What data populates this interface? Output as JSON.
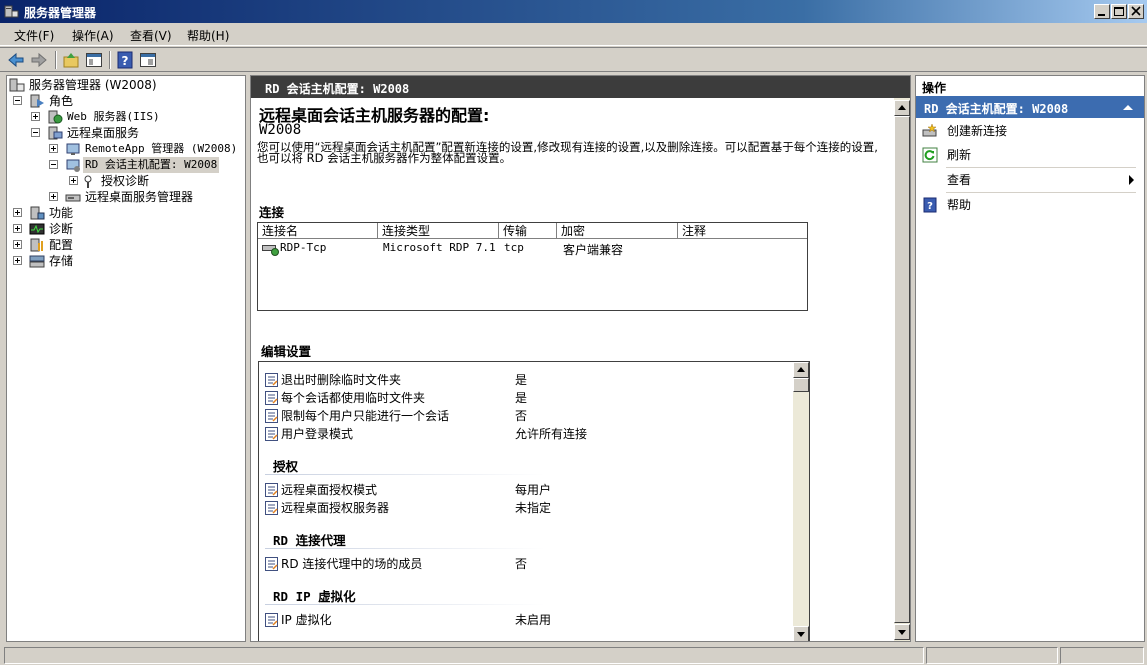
{
  "window": {
    "title": "服务器管理器",
    "controls": [
      "minimize",
      "maximize",
      "close"
    ]
  },
  "menu": [
    "文件(F)",
    "操作(A)",
    "查看(V)",
    "帮助(H)"
  ],
  "toolbar": {
    "icons": [
      "back-arrow-icon",
      "forward-arrow-icon",
      "up-folder-icon",
      "show-tree-icon",
      "help-icon",
      "properties-icon"
    ]
  },
  "tree": {
    "root": "服务器管理器 (W2008)",
    "roles": "角色",
    "web_server": "Web 服务器(IIS)",
    "rds": "远程桌面服务",
    "remoteapp": "RemoteApp 管理器 (W2008)",
    "rd_host_config": "RD 会话主机配置: W2008",
    "licensing_diag": "授权诊断",
    "rd_manager": "远程桌面服务管理器",
    "features": "功能",
    "diagnostics": "诊断",
    "configuration": "配置",
    "storage": "存储"
  },
  "main": {
    "header": "RD 会话主机配置: W2008",
    "heading": "远程桌面会话主机服务器的配置:",
    "subheading": "W2008",
    "description": "您可以使用“远程桌面会话主机配置”配置新连接的设置,修改现有连接的设置,以及删除连接。可以配置基于每个连接的设置,也可以将 RD 会话主机服务器作为整体配置设置。",
    "connections_title": "连接",
    "connections": {
      "columns": [
        "连接名",
        "连接类型",
        "传输",
        "加密",
        "注释"
      ],
      "rows": [
        {
          "name": "RDP-Tcp",
          "type": "Microsoft RDP 7.1",
          "transport": "tcp",
          "encryption": "客户端兼容",
          "comment": ""
        }
      ]
    },
    "edit_title": "编辑设置",
    "settings": {
      "general": [
        {
          "label": "退出时删除临时文件夹",
          "value": "是"
        },
        {
          "label": "每个会话都使用临时文件夹",
          "value": "是"
        },
        {
          "label": "限制每个用户只能进行一个会话",
          "value": "否"
        },
        {
          "label": "用户登录模式",
          "value": "允许所有连接"
        }
      ],
      "licensing_title": "授权",
      "licensing": [
        {
          "label": "远程桌面授权模式",
          "value": "每用户"
        },
        {
          "label": "远程桌面授权服务器",
          "value": "未指定"
        }
      ],
      "broker_title": "RD 连接代理",
      "broker": [
        {
          "label": "RD 连接代理中的场的成员",
          "value": "否"
        }
      ],
      "ipv_title": "RD IP 虚拟化",
      "ipv": [
        {
          "label": "IP 虚拟化",
          "value": "未启用"
        }
      ]
    }
  },
  "actions": {
    "header": "操作",
    "sub_header": "RD 会话主机配置: W2008",
    "items": [
      {
        "label": "创建新连接",
        "icon": "new-connection-icon"
      },
      {
        "label": "刷新",
        "icon": "refresh-icon"
      },
      {
        "label": "查看",
        "icon": "submenu-arrow-icon"
      },
      {
        "label": "帮助",
        "icon": "help-icon"
      }
    ]
  }
}
